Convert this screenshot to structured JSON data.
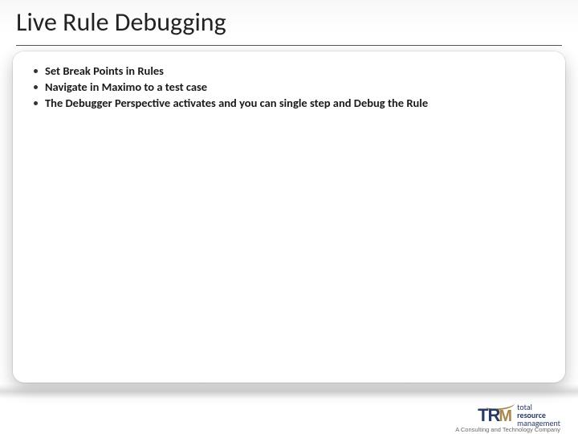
{
  "title": "Live Rule Debugging",
  "bullets": [
    "Set Break Points in Rules",
    "Navigate in Maximo to a test case",
    "The Debugger Perspective activates and you can single step and Debug the Rule"
  ],
  "logo": {
    "mark_t": "T",
    "mark_r": "R",
    "mark_m": "M",
    "line1": "total",
    "line2": "resource",
    "line3": "management",
    "tagline": "A Consulting and Technology Company"
  }
}
